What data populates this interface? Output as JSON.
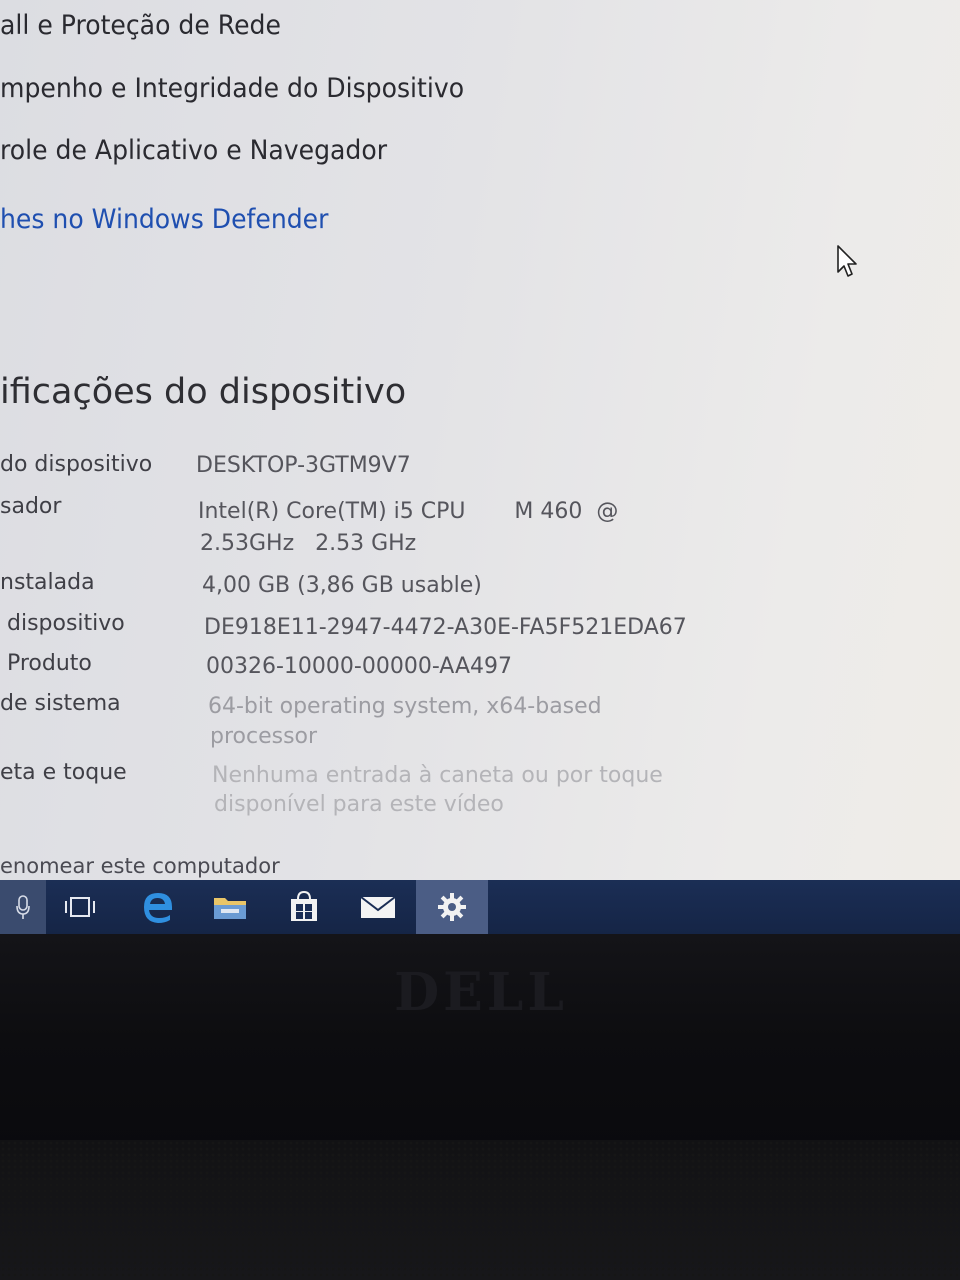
{
  "menu": {
    "firewall": "all e Proteção de Rede",
    "performance": "mpenho e Integridade do Dispositivo",
    "app_control": "role de Aplicativo e Navegador",
    "defender_details": "hes no Windows Defender"
  },
  "section_title": "ificações do dispositivo",
  "specs": [
    {
      "label": "do dispositivo",
      "value": "DESKTOP-3GTM9V7"
    },
    {
      "label": "sador",
      "value_line1": "Intel(R) Core(TM) i5 CPU       M 460  @",
      "value_line2": "2.53GHz   2.53 GHz"
    },
    {
      "label": "nstalada",
      "value": "4,00 GB (3,86 GB usable)"
    },
    {
      "label": " dispositivo",
      "value": "DE918E11-2947-4472-A30E-FA5F521EDA67"
    },
    {
      "label": " Produto",
      "value": "00326-10000-00000-AA497"
    },
    {
      "label": "de sistema",
      "value_line1": "64-bit operating system, x64-based",
      "value_line2": "processor"
    },
    {
      "label": "eta e toque",
      "value_line1": "Nenhuma entrada à caneta ou por toque",
      "value_line2": "disponível para este vídeo"
    }
  ],
  "rename_link": "enomear este computador",
  "taskbar": {
    "icons": [
      "microphone-icon",
      "task-view-icon",
      "edge-icon",
      "file-explorer-icon",
      "store-icon",
      "mail-icon",
      "settings-icon"
    ],
    "active": "settings-icon",
    "color": "#1b2e55"
  },
  "bezel": {
    "logo": "DELL"
  }
}
